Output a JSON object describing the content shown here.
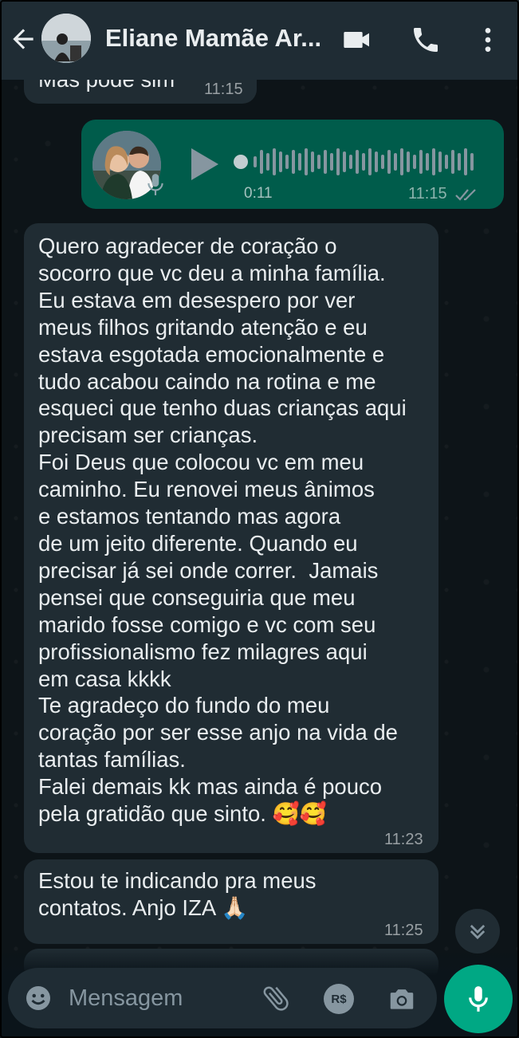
{
  "header": {
    "contact_name": "Eliane Mamãe Ar...",
    "icons": [
      "back-arrow-icon",
      "video-call-icon",
      "voice-call-icon",
      "more-options-icon"
    ]
  },
  "messages": {
    "partial_in": {
      "text": "Mas pode sim",
      "time": "11:15"
    },
    "voice_out": {
      "duration": "0:11",
      "time": "11:15",
      "status": "read"
    },
    "long_in": {
      "text": "Quero agradecer de coração o\nsocorro que vc deu a minha família.\nEu estava em desespero por ver\nmeus filhos gritando atenção e eu\nestava esgotada emocionalmente e\ntudo acabou caindo na rotina e me\nesqueci que tenho duas crianças aqui\nprecisam ser crianças.\nFoi Deus que colocou vc em meu\ncaminho. Eu renovei meus ânimos\ne estamos tentando mas agora\nde um jeito diferente. Quando eu\nprecisar já sei onde correr.  Jamais\npensei que conseguiria que meu\nmarido fosse comigo e vc com seu\nprofissionalismo fez milagres aqui\nem casa kkkk\nTe agradeço do fundo do meu\ncoração por ser esse anjo na vida de\ntantas famílias.\nFalei demais kk mas ainda é pouco\npela gratidão que sinto. 🥰🥰",
      "time": "11:23"
    },
    "short_in": {
      "text": "Estou te indicando pra meus\ncontatos. Anjo IZA 🙏🏻",
      "time": "11:25"
    }
  },
  "composer": {
    "placeholder": "Mensagem",
    "pix_label": "R$"
  },
  "colors": {
    "header_bg": "#1f2c34",
    "incoming_bubble": "#202c33",
    "outgoing_bubble": "#005c4b",
    "accent": "#00a884",
    "read_ticks": "#53bdeb"
  }
}
